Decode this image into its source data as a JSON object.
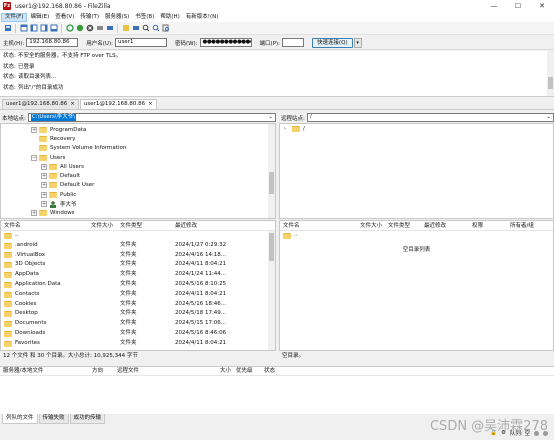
{
  "window": {
    "title": "user1@192.168.80.86 - FileZilla",
    "app_icon_letter": "Fz"
  },
  "menu": [
    "文件(F)",
    "编辑(E)",
    "查看(V)",
    "传输(T)",
    "服务器(S)",
    "书签(B)",
    "帮助(H)",
    "有新版本!(N)"
  ],
  "quickconnect": {
    "host_label": "主机(H):",
    "host_value": "192.168.80.86",
    "user_label": "用户名(U):",
    "user_value": "user1",
    "pass_label": "密码(W):",
    "pass_value": "●●●●●●●●●●●●",
    "port_label": "端口(P):",
    "port_value": "",
    "connect_label": "快速连接(Q)",
    "drop_arrow": "▾"
  },
  "log": [
    {
      "label": "状态:",
      "text": "不安全的服务器，不支持 FTP over TLS。"
    },
    {
      "label": "状态:",
      "text": "已登录"
    },
    {
      "label": "状态:",
      "text": "读取目录列表..."
    },
    {
      "label": "状态:",
      "text": "列出\"/\"的目录成功"
    }
  ],
  "tabs": [
    {
      "label": "user1@192.168.80.86",
      "close": "×"
    },
    {
      "label": "user1@192.168.80.86",
      "close": "×"
    }
  ],
  "local": {
    "site_label": "本地站点:",
    "path": "C:\\Users\\李大爷\\",
    "tree": [
      {
        "label": "ProgramData",
        "expander": "+",
        "indent": 1
      },
      {
        "label": "Recovery",
        "expander": "",
        "indent": 1
      },
      {
        "label": "System Volume Information",
        "expander": "",
        "indent": 1
      },
      {
        "label": "Users",
        "expander": "−",
        "indent": 1
      },
      {
        "label": "All Users",
        "expander": "+",
        "indent": 2
      },
      {
        "label": "Default",
        "expander": "+",
        "indent": 2
      },
      {
        "label": "Default User",
        "expander": "+",
        "indent": 2
      },
      {
        "label": "Public",
        "expander": "+",
        "indent": 2
      },
      {
        "label": "李大爷",
        "expander": "+",
        "indent": 2
      },
      {
        "label": "Windows",
        "expander": "+",
        "indent": 1
      }
    ],
    "columns": [
      "文件名",
      "文件大小",
      "文件类型",
      "最近修改"
    ],
    "files": [
      {
        "name": "..",
        "size": "",
        "type": "",
        "modified": ""
      },
      {
        "name": ".android",
        "size": "",
        "type": "文件夹",
        "modified": "2024/1/27 0:29:32"
      },
      {
        "name": ".VirtualBox",
        "size": "",
        "type": "文件夹",
        "modified": "2024/4/16 14:18..."
      },
      {
        "name": "3D Objects",
        "size": "",
        "type": "文件夹",
        "modified": "2024/4/11 8:04:21"
      },
      {
        "name": "AppData",
        "size": "",
        "type": "文件夹",
        "modified": "2024/1/24 11:44..."
      },
      {
        "name": "Application Data",
        "size": "",
        "type": "文件夹",
        "modified": "2024/5/16 8:10:25"
      },
      {
        "name": "Contacts",
        "size": "",
        "type": "文件夹",
        "modified": "2024/4/11 8:04:21"
      },
      {
        "name": "Cookies",
        "size": "",
        "type": "文件夹",
        "modified": "2024/5/16 18:46..."
      },
      {
        "name": "Desktop",
        "size": "",
        "type": "文件夹",
        "modified": "2024/5/18 17:49..."
      },
      {
        "name": "Documents",
        "size": "",
        "type": "文件夹",
        "modified": "2024/5/15 17:06..."
      },
      {
        "name": "Downloads",
        "size": "",
        "type": "文件夹",
        "modified": "2024/5/16 8:46:06"
      },
      {
        "name": "Favorites",
        "size": "",
        "type": "文件夹",
        "modified": "2024/4/11 8:04:21"
      }
    ],
    "status": "12 个文件 和 30 个目录。大小总计: 10,925,344 字节"
  },
  "remote": {
    "site_label": "远程站点:",
    "path": "/",
    "tree": [
      {
        "label": "/",
        "expander": "",
        "indent": 1
      }
    ],
    "columns": [
      "文件名",
      "文件大小",
      "文件类型",
      "最近修改",
      "权限",
      "所有者/组"
    ],
    "files": [
      {
        "name": ".."
      }
    ],
    "empty_text": "空目录列表",
    "status": "空目录。"
  },
  "queue": {
    "columns": [
      "服务器/本地文件",
      "方向",
      "远程文件",
      "大小",
      "优先级",
      "状态"
    ]
  },
  "bottom_tabs": [
    "列队的文件",
    "传输失败",
    "成功的传输"
  ],
  "statusbar": {
    "queue_text": "队列: 空"
  },
  "watermark": "CSDN @吴沛霖278",
  "colors": {
    "accent": "#0078d7",
    "folder": "#f7d26b",
    "app_icon": "#b01010"
  }
}
